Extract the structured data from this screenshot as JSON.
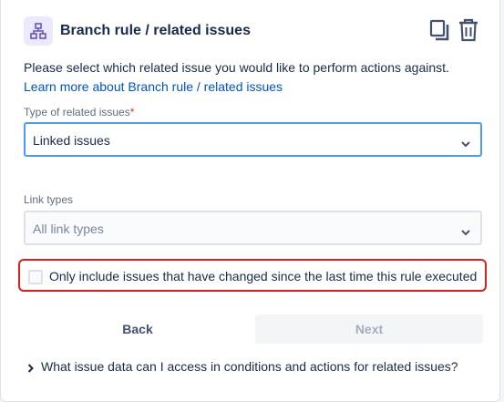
{
  "header": {
    "title": "Branch rule / related issues",
    "icon": "branch-icon",
    "actions": [
      "copy-icon",
      "trash-icon"
    ]
  },
  "description": {
    "text": "Please select which related issue you would like to perform actions against.",
    "link": "Learn more about Branch rule / related issues"
  },
  "type_field": {
    "label": "Type of related issues",
    "required_mark": "*",
    "value": "Linked issues"
  },
  "link_types_field": {
    "label": "Link types",
    "placeholder": "All link types"
  },
  "checkbox": {
    "label": "Only include issues that have changed since the last time this rule executed",
    "checked": false
  },
  "buttons": {
    "back": "Back",
    "next": "Next"
  },
  "faq": {
    "text": "What issue data can I access in conditions and actions for related issues?"
  },
  "colors": {
    "accent_link": "#0052cc",
    "focus_border": "#4c9aff",
    "highlight_border": "#e01e1e",
    "icon_bg": "#ece9ff",
    "icon_fg": "#6554c0"
  }
}
